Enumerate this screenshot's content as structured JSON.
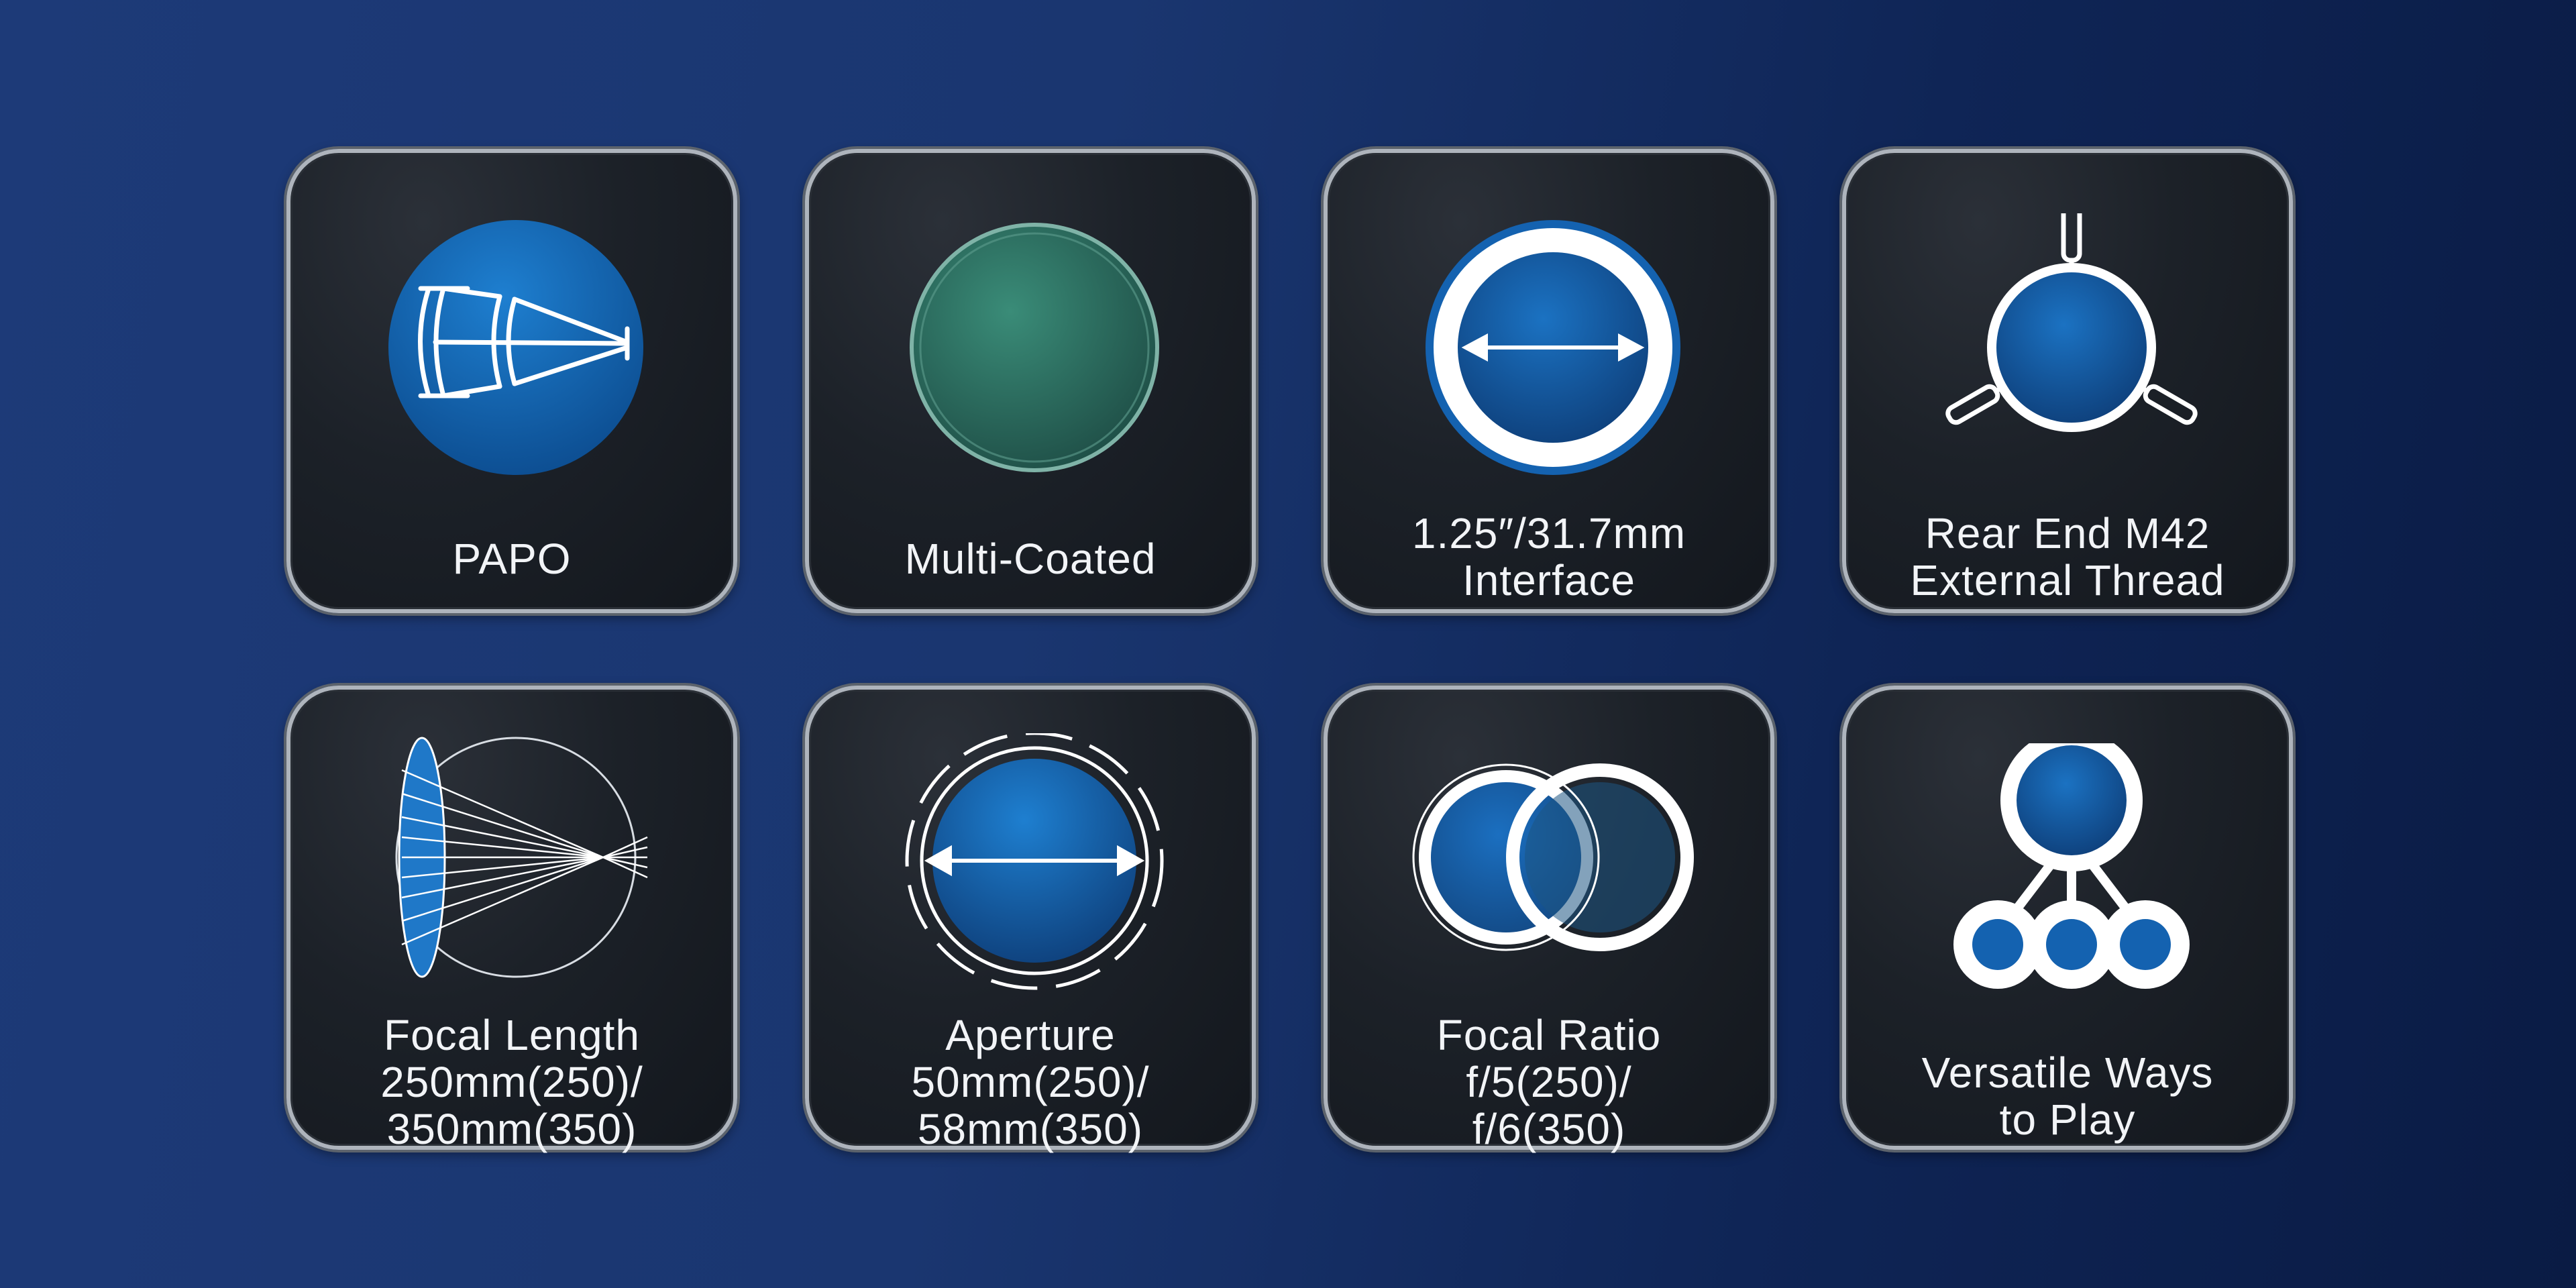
{
  "features": [
    {
      "icon": "lens-cross-section-icon",
      "lines": [
        "PAPO"
      ]
    },
    {
      "icon": "coated-lens-icon",
      "lines": [
        "Multi-Coated"
      ]
    },
    {
      "icon": "interface-ring-icon",
      "lines": [
        "1.25″/31.7mm",
        "Interface"
      ]
    },
    {
      "icon": "m42-thread-icon",
      "lines": [
        "Rear End M42",
        "External Thread"
      ]
    },
    {
      "icon": "focal-length-icon",
      "lines": [
        "Focal Length",
        "250mm(250)/",
        "350mm(350)"
      ]
    },
    {
      "icon": "aperture-icon",
      "lines": [
        "Aperture",
        "50mm(250)/",
        "58mm(350)"
      ]
    },
    {
      "icon": "focal-ratio-icon",
      "lines": [
        "Focal Ratio",
        "f/5(250)/",
        "f/6(350)"
      ]
    },
    {
      "icon": "versatile-ways-icon",
      "lines": [
        "Versatile Ways",
        "to Play"
      ]
    }
  ],
  "colors": {
    "accent_blue": "#1462b0",
    "label_text": "#f2f4f7",
    "coating_green": "#2f6f62"
  }
}
